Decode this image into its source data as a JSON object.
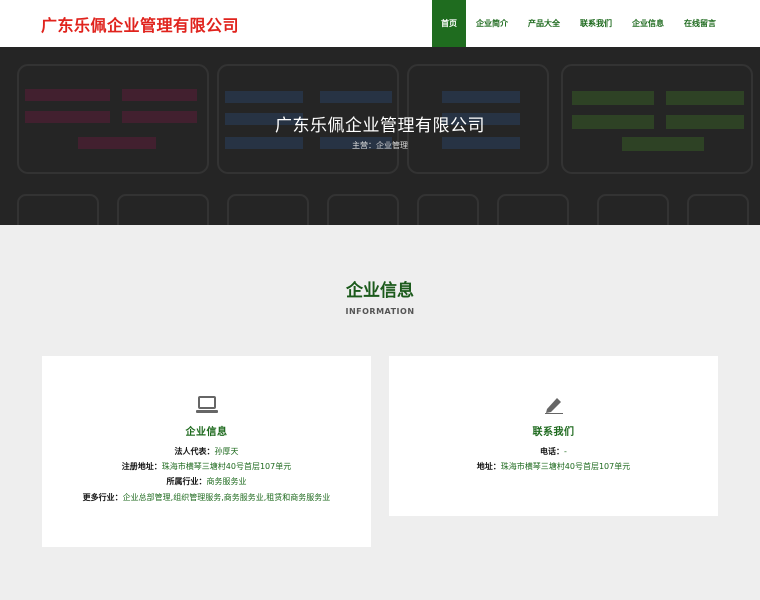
{
  "header": {
    "logo": "广东乐佩企业管理有限公司",
    "nav": [
      "首页",
      "企业简介",
      "产品大全",
      "联系我们",
      "企业信息",
      "在线留言"
    ]
  },
  "banner": {
    "title": "广东乐佩企业管理有限公司",
    "subtitle": "主营：企业管理"
  },
  "section": {
    "title": "企业信息",
    "subtitle": "INFORMATION"
  },
  "company_card": {
    "icon": "laptop-icon",
    "title": "企业信息",
    "rows": [
      {
        "label": "法人代表：",
        "value": "孙厚天"
      },
      {
        "label": "注册地址：",
        "value": "珠海市横琴三塘村40号首层107单元"
      },
      {
        "label": "所属行业：",
        "value": "商务服务业"
      },
      {
        "label": "更多行业：",
        "value": "企业总部管理,组织管理服务,商务服务业,租赁和商务服务业"
      }
    ]
  },
  "contact_card": {
    "icon": "pencil-icon",
    "title": "联系我们",
    "rows": [
      {
        "label": "电话：",
        "value": "-"
      },
      {
        "label": "地址：",
        "value": "珠海市横琴三塘村40号首层107单元"
      }
    ]
  },
  "colors": {
    "brand_red": "#e0231d",
    "brand_green": "#1f6c1f",
    "background": "#eeeeee"
  }
}
